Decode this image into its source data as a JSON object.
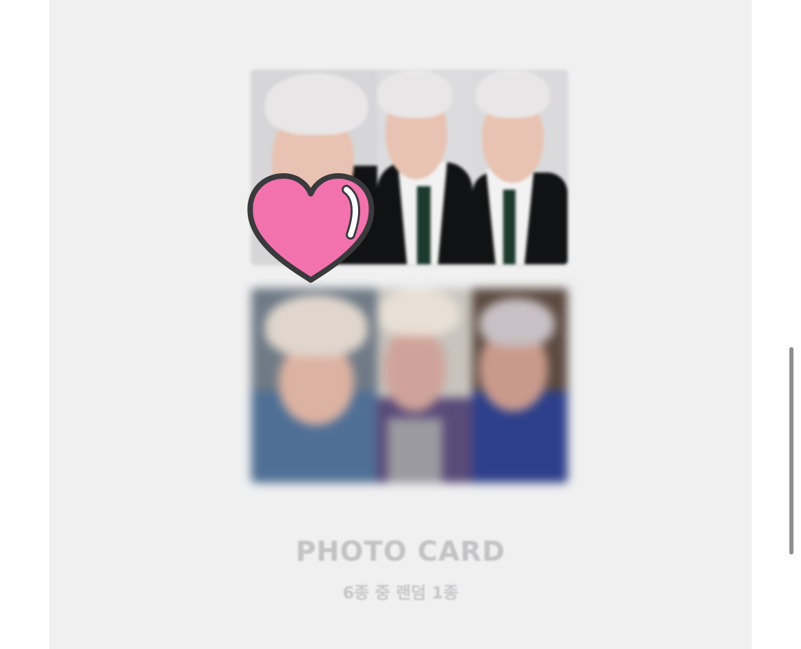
{
  "photocard": {
    "title": "PHOTO CARD",
    "subtitle": "6종 중 랜덤 1종",
    "card_count": 6
  },
  "colors": {
    "panel_background": "#f0f0f1",
    "title_text": "#c3c3c5",
    "heart_fill": "#f272ad",
    "heart_outline": "#3a3a3c",
    "scrollbar": "#8e8e92"
  },
  "icons": {
    "overlay_sticker": "heart-icon"
  }
}
